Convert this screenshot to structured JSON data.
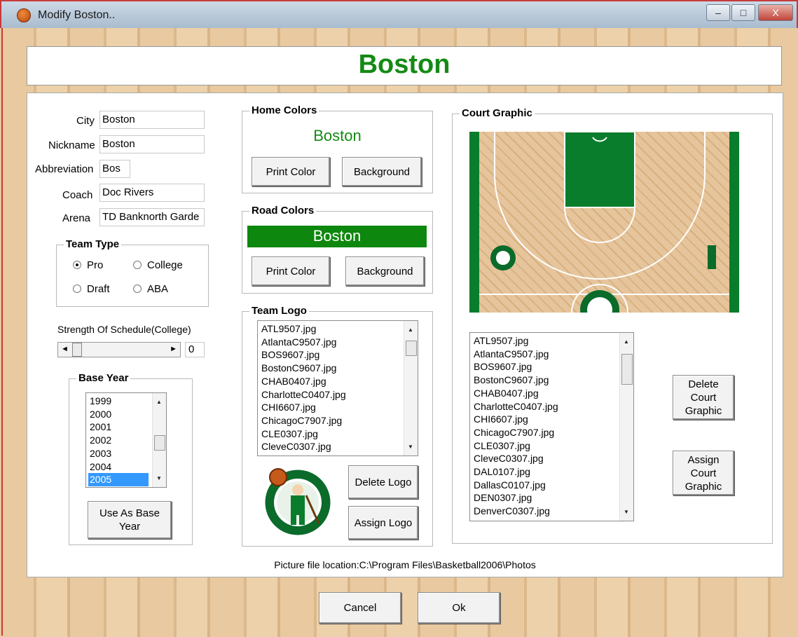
{
  "window": {
    "title": "Modify Boston..",
    "minimize": "–",
    "maximize": "□",
    "close": "X"
  },
  "header": {
    "title": "Boston"
  },
  "team_info": {
    "city_label": "City",
    "city_value": "Boston",
    "nickname_label": "Nickname",
    "nickname_value": "Boston",
    "abbreviation_label": "Abbreviation",
    "abbreviation_value": "Bos",
    "coach_label": "Coach",
    "coach_value": "Doc Rivers",
    "arena_label": "Arena",
    "arena_value": "TD Banknorth Garde"
  },
  "team_type": {
    "title": "Team Type",
    "options": [
      {
        "label": "Pro",
        "selected": true
      },
      {
        "label": "College",
        "selected": false
      },
      {
        "label": "Draft",
        "selected": false
      },
      {
        "label": "ABA",
        "selected": false
      }
    ]
  },
  "strength": {
    "label": "Strength Of Schedule(College)",
    "value": "0",
    "left_arrow": "◄",
    "right_arrow": "►"
  },
  "base_year": {
    "title": "Base Year",
    "items": [
      "1999",
      "2000",
      "2001",
      "2002",
      "2003",
      "2004",
      "2005"
    ],
    "selected": "2005",
    "button": "Use As  Base Year"
  },
  "home_colors": {
    "title": "Home Colors",
    "sample": "Boston",
    "print_button": "Print Color",
    "background_button": "Background",
    "text_color": "#148a14",
    "bg_color": "#ffffff"
  },
  "road_colors": {
    "title": "Road Colors",
    "sample": "Boston",
    "print_button": "Print Color",
    "background_button": "Background",
    "text_color": "#ffffff",
    "bg_color": "#0d870d"
  },
  "team_logo": {
    "title": "Team Logo",
    "files": [
      "ATL9507.jpg",
      "AtlantaC9507.jpg",
      "BOS9607.jpg",
      "BostonC9607.jpg",
      "CHAB0407.jpg",
      "CharlotteC0407.jpg",
      "CHI6607.jpg",
      "ChicagoC7907.jpg",
      "CLE0307.jpg",
      "CleveC0307.jpg"
    ],
    "delete_button": "Delete Logo",
    "assign_button": "Assign Logo"
  },
  "court_graphic": {
    "title": "Court Graphic",
    "files": [
      "ATL9507.jpg",
      "AtlantaC9507.jpg",
      "BOS9607.jpg",
      "BostonC9607.jpg",
      "CHAB0407.jpg",
      "CharlotteC0407.jpg",
      "CHI6607.jpg",
      "ChicagoC7907.jpg",
      "CLE0307.jpg",
      "CleveC0307.jpg",
      "DAL0107.jpg",
      "DallasC0107.jpg",
      "DEN0307.jpg",
      "DenverC0307.jpg"
    ],
    "delete_button": "Delete Court Graphic",
    "assign_button": "Assign Court Graphic"
  },
  "status": {
    "picture_location": "Picture file location:C:\\Program Files\\Basketball2006\\Photos"
  },
  "footer": {
    "cancel_button": "Cancel",
    "ok_button": "Ok"
  }
}
